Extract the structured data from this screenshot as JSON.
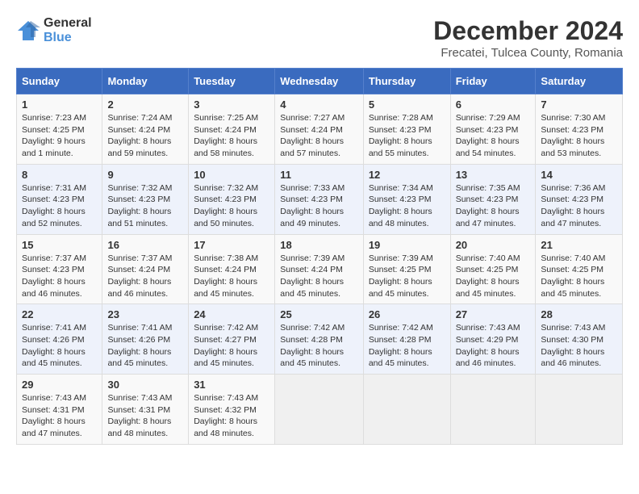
{
  "logo": {
    "general": "General",
    "blue": "Blue"
  },
  "title": "December 2024",
  "subtitle": "Frecatei, Tulcea County, Romania",
  "days_of_week": [
    "Sunday",
    "Monday",
    "Tuesday",
    "Wednesday",
    "Thursday",
    "Friday",
    "Saturday"
  ],
  "weeks": [
    [
      {
        "day": 1,
        "info": "Sunrise: 7:23 AM\nSunset: 4:25 PM\nDaylight: 9 hours\nand 1 minute."
      },
      {
        "day": 2,
        "info": "Sunrise: 7:24 AM\nSunset: 4:24 PM\nDaylight: 8 hours\nand 59 minutes."
      },
      {
        "day": 3,
        "info": "Sunrise: 7:25 AM\nSunset: 4:24 PM\nDaylight: 8 hours\nand 58 minutes."
      },
      {
        "day": 4,
        "info": "Sunrise: 7:27 AM\nSunset: 4:24 PM\nDaylight: 8 hours\nand 57 minutes."
      },
      {
        "day": 5,
        "info": "Sunrise: 7:28 AM\nSunset: 4:23 PM\nDaylight: 8 hours\nand 55 minutes."
      },
      {
        "day": 6,
        "info": "Sunrise: 7:29 AM\nSunset: 4:23 PM\nDaylight: 8 hours\nand 54 minutes."
      },
      {
        "day": 7,
        "info": "Sunrise: 7:30 AM\nSunset: 4:23 PM\nDaylight: 8 hours\nand 53 minutes."
      }
    ],
    [
      {
        "day": 8,
        "info": "Sunrise: 7:31 AM\nSunset: 4:23 PM\nDaylight: 8 hours\nand 52 minutes."
      },
      {
        "day": 9,
        "info": "Sunrise: 7:32 AM\nSunset: 4:23 PM\nDaylight: 8 hours\nand 51 minutes."
      },
      {
        "day": 10,
        "info": "Sunrise: 7:32 AM\nSunset: 4:23 PM\nDaylight: 8 hours\nand 50 minutes."
      },
      {
        "day": 11,
        "info": "Sunrise: 7:33 AM\nSunset: 4:23 PM\nDaylight: 8 hours\nand 49 minutes."
      },
      {
        "day": 12,
        "info": "Sunrise: 7:34 AM\nSunset: 4:23 PM\nDaylight: 8 hours\nand 48 minutes."
      },
      {
        "day": 13,
        "info": "Sunrise: 7:35 AM\nSunset: 4:23 PM\nDaylight: 8 hours\nand 47 minutes."
      },
      {
        "day": 14,
        "info": "Sunrise: 7:36 AM\nSunset: 4:23 PM\nDaylight: 8 hours\nand 47 minutes."
      }
    ],
    [
      {
        "day": 15,
        "info": "Sunrise: 7:37 AM\nSunset: 4:23 PM\nDaylight: 8 hours\nand 46 minutes."
      },
      {
        "day": 16,
        "info": "Sunrise: 7:37 AM\nSunset: 4:24 PM\nDaylight: 8 hours\nand 46 minutes."
      },
      {
        "day": 17,
        "info": "Sunrise: 7:38 AM\nSunset: 4:24 PM\nDaylight: 8 hours\nand 45 minutes."
      },
      {
        "day": 18,
        "info": "Sunrise: 7:39 AM\nSunset: 4:24 PM\nDaylight: 8 hours\nand 45 minutes."
      },
      {
        "day": 19,
        "info": "Sunrise: 7:39 AM\nSunset: 4:25 PM\nDaylight: 8 hours\nand 45 minutes."
      },
      {
        "day": 20,
        "info": "Sunrise: 7:40 AM\nSunset: 4:25 PM\nDaylight: 8 hours\nand 45 minutes."
      },
      {
        "day": 21,
        "info": "Sunrise: 7:40 AM\nSunset: 4:25 PM\nDaylight: 8 hours\nand 45 minutes."
      }
    ],
    [
      {
        "day": 22,
        "info": "Sunrise: 7:41 AM\nSunset: 4:26 PM\nDaylight: 8 hours\nand 45 minutes."
      },
      {
        "day": 23,
        "info": "Sunrise: 7:41 AM\nSunset: 4:26 PM\nDaylight: 8 hours\nand 45 minutes."
      },
      {
        "day": 24,
        "info": "Sunrise: 7:42 AM\nSunset: 4:27 PM\nDaylight: 8 hours\nand 45 minutes."
      },
      {
        "day": 25,
        "info": "Sunrise: 7:42 AM\nSunset: 4:28 PM\nDaylight: 8 hours\nand 45 minutes."
      },
      {
        "day": 26,
        "info": "Sunrise: 7:42 AM\nSunset: 4:28 PM\nDaylight: 8 hours\nand 45 minutes."
      },
      {
        "day": 27,
        "info": "Sunrise: 7:43 AM\nSunset: 4:29 PM\nDaylight: 8 hours\nand 46 minutes."
      },
      {
        "day": 28,
        "info": "Sunrise: 7:43 AM\nSunset: 4:30 PM\nDaylight: 8 hours\nand 46 minutes."
      }
    ],
    [
      {
        "day": 29,
        "info": "Sunrise: 7:43 AM\nSunset: 4:31 PM\nDaylight: 8 hours\nand 47 minutes."
      },
      {
        "day": 30,
        "info": "Sunrise: 7:43 AM\nSunset: 4:31 PM\nDaylight: 8 hours\nand 48 minutes."
      },
      {
        "day": 31,
        "info": "Sunrise: 7:43 AM\nSunset: 4:32 PM\nDaylight: 8 hours\nand 48 minutes."
      },
      null,
      null,
      null,
      null
    ]
  ]
}
